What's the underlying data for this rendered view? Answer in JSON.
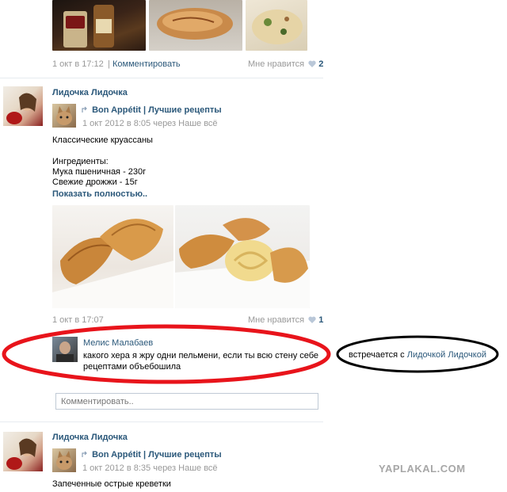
{
  "post0": {
    "date": "1 окт в 17:12",
    "comment_link": "Комментировать",
    "like_label": "Мне нравится",
    "like_count": "2"
  },
  "post1": {
    "author": "Лидочка Лидочка",
    "repost_source": "Bon Appétit | Лучшие рецепты",
    "repost_meta": "1 окт 2012 в 8:05 через Наше всё",
    "title": "Классические круассаны",
    "ingredients_header": "Ингредиенты:",
    "ingredient_1": "Мука пшеничная - 230г",
    "ingredient_2": "Свежие дрожжи - 15г",
    "show_more": "Показать полностью..",
    "date": "1 окт в 17:07",
    "like_label": "Мне нравится",
    "like_count": "1"
  },
  "comment": {
    "author": "Мелис Малабаев",
    "text_line1": "какого хера я жру одни пельмени, если ты всю стену себе",
    "text_line2": "рецептами объебошила",
    "input_placeholder": "Комментировать.."
  },
  "annotation": {
    "prefix": "встречается с",
    "name": "Лидочкой Лидочкой"
  },
  "post2": {
    "author": "Лидочка Лидочка",
    "repost_source": "Bon Appétit | Лучшие рецепты",
    "repost_meta": "1 окт 2012 в 8:35 через Наше всё",
    "title": "Запеченные острые креветки"
  },
  "watermark": "YAPLAKAL.COM",
  "colors": {
    "link": "#2b587a",
    "meta": "#999999",
    "highlight_red": "#e8141b",
    "ellipse_black": "#000000"
  }
}
